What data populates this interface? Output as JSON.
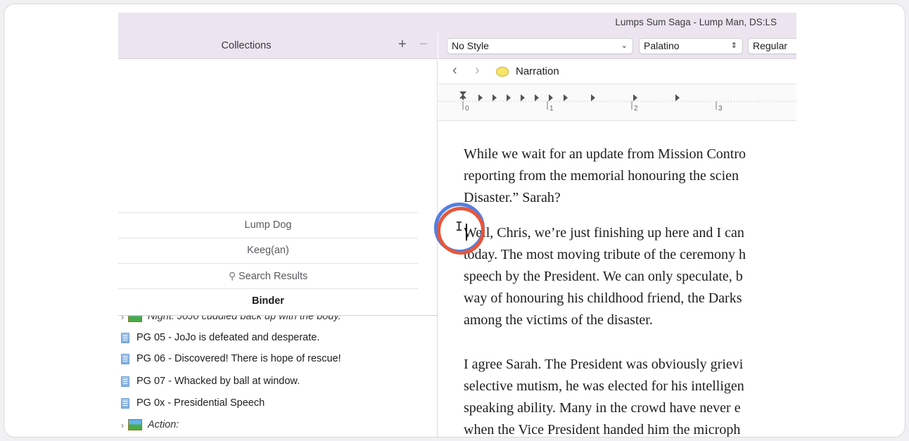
{
  "window": {
    "title": "Lumps Sum Saga - Lump Man, DS:LS"
  },
  "collections": {
    "header": "Collections",
    "add": "+",
    "remove": "−",
    "tabs": [
      {
        "label": "Lump Dog"
      },
      {
        "label": "Keeg(an)"
      },
      {
        "label": "Search Results"
      },
      {
        "label": "Binder"
      }
    ]
  },
  "binder": {
    "partial_item": "Night: JoJo cuddled back up with the body.",
    "items": [
      {
        "label": "PG 05 -  JoJo is defeated and desperate."
      },
      {
        "label": "PG 06 - Discovered! There is hope of rescue!"
      },
      {
        "label": "PG 07 - Whacked by ball at window."
      },
      {
        "label": "PG 0x - Presidential Speech"
      }
    ],
    "folder": "Action:"
  },
  "format_bar": {
    "style": "No Style",
    "font": "Palatino",
    "weight": "Regular"
  },
  "navigation": {
    "back": "‹",
    "forward": "›",
    "document": "Narration",
    "icon": "speech-bubble-icon"
  },
  "ruler": {
    "marks": [
      "0",
      "1",
      "2",
      "3"
    ]
  },
  "editor": {
    "paragraphs": [
      [
        "While we wait for an update from Mission Contro",
        "reporting from the memorial honouring the scien",
        "Disaster.” Sarah?"
      ],
      [
        "Well, Chris, we’re just finishing up here and I can",
        "today. The most moving tribute of the ceremony h",
        "speech by the President. We can only speculate, b",
        "way of honouring his childhood friend, the Darks",
        "among the victims of the disaster."
      ],
      [
        "I agree Sarah. The President was obviously grievi",
        "selective mutism, he was elected for his intelligen",
        "speaking ability. Many in the crowd have never e",
        "when the Vice President handed him the microph"
      ]
    ]
  },
  "colors": {
    "toolbar_bg": "#ece5f0",
    "cursor_ring_blue": "#4a78e0",
    "cursor_ring_red": "#e8563a"
  }
}
